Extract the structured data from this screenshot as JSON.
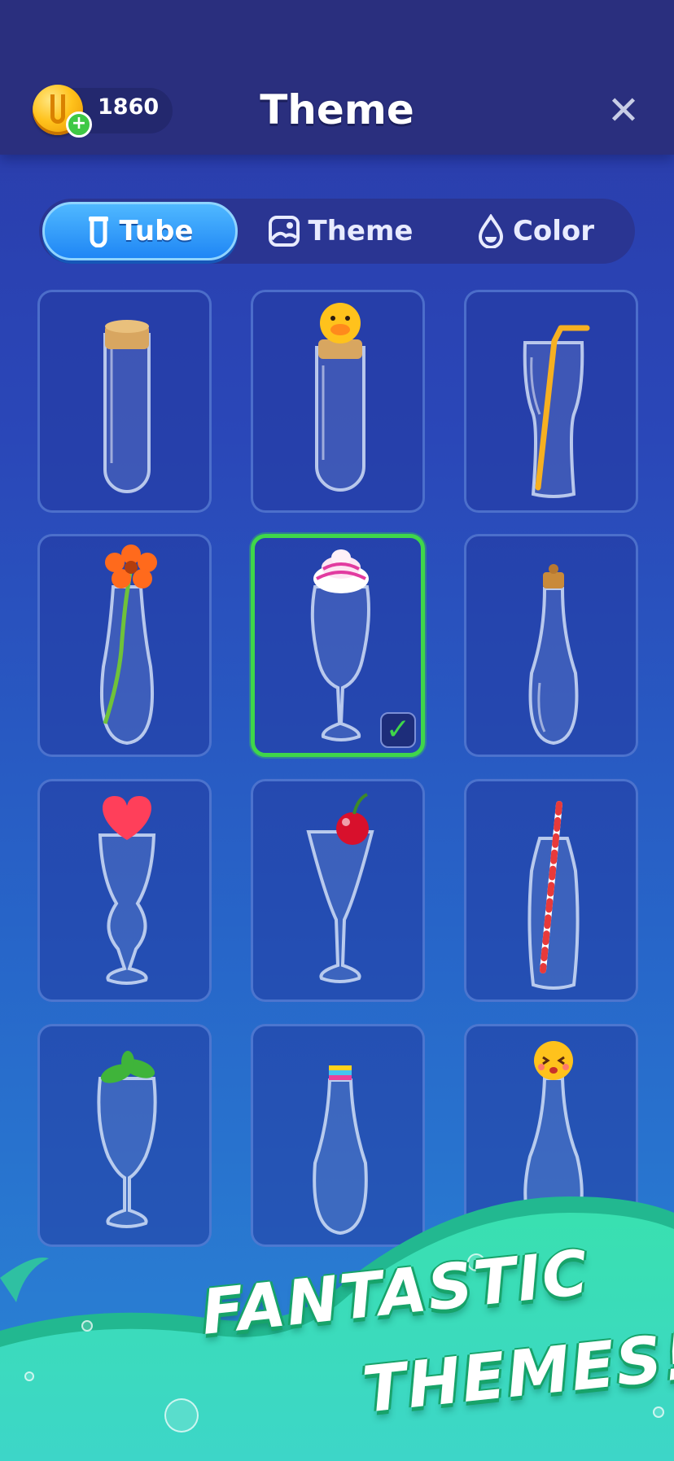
{
  "header": {
    "coins": "1860",
    "title": "Theme"
  },
  "tabs": [
    {
      "label": "Tube",
      "icon": "tube-icon",
      "active": true
    },
    {
      "label": "Theme",
      "icon": "picture-icon",
      "active": false
    },
    {
      "label": "Color",
      "icon": "drop-icon",
      "active": false
    }
  ],
  "items": [
    {
      "name": "cork-test-tube",
      "topper": "cork"
    },
    {
      "name": "duck-test-tube",
      "topper": "duck"
    },
    {
      "name": "straw-glass",
      "topper": "straw"
    },
    {
      "name": "flower-vase",
      "topper": "flower"
    },
    {
      "name": "whipped-cream-glass",
      "topper": "cream",
      "selected": true
    },
    {
      "name": "cork-bottle",
      "topper": "small cork"
    },
    {
      "name": "heart-glass",
      "topper": "heart"
    },
    {
      "name": "cherry-glass",
      "topper": "cherry"
    },
    {
      "name": "striped-straw-bottle",
      "topper": "striped straw"
    },
    {
      "name": "mint-glass",
      "topper": "mint"
    },
    {
      "name": "rainbow-cap-bottle",
      "topper": "rainbow cap"
    },
    {
      "name": "emoji-bottle",
      "topper": "emoji"
    }
  ],
  "banner": {
    "line1": "FANTASTIC",
    "line2": "THEMES!"
  },
  "colors": {
    "accent_green": "#3fd64a",
    "tab_active": "#2f9cff",
    "coin": "#ffc21c"
  }
}
